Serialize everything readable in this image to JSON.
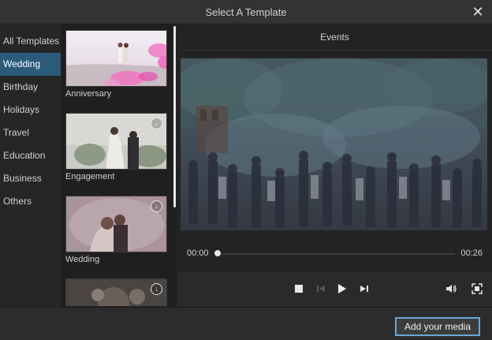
{
  "window": {
    "title": "Select A Template"
  },
  "sidebar": {
    "items": [
      {
        "label": "All Templates"
      },
      {
        "label": "Wedding",
        "active": true
      },
      {
        "label": "Birthday"
      },
      {
        "label": "Holidays"
      },
      {
        "label": "Travel"
      },
      {
        "label": "Education"
      },
      {
        "label": "Business"
      },
      {
        "label": "Others"
      }
    ]
  },
  "templates": [
    {
      "label": "Anniversary",
      "icon": "none"
    },
    {
      "label": "Engagement",
      "icon": "download-icon"
    },
    {
      "label": "Wedding",
      "icon": "download-icon"
    },
    {
      "label": "",
      "icon": "download-icon"
    }
  ],
  "preview": {
    "title": "Events",
    "time_current": "00:00",
    "time_total": "00:26",
    "progress": 0
  },
  "footer": {
    "primary_button": "Add your media"
  },
  "colors": {
    "accent": "#2b5a7a",
    "button_border": "#6aa7d8"
  }
}
